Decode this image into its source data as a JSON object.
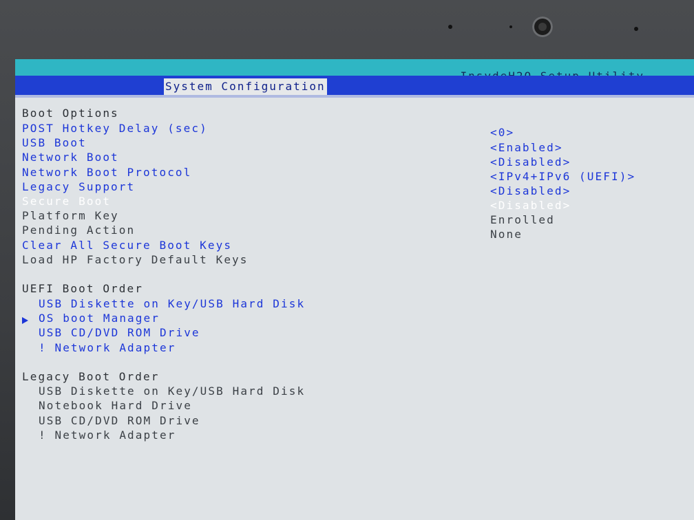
{
  "header": {
    "utility_title": "InsydeH2O Setup Utility",
    "active_menu": "System Configuration"
  },
  "boot_options": {
    "heading": "Boot Options",
    "items": [
      {
        "label": "POST Hotkey Delay (sec)",
        "value": "<0>"
      },
      {
        "label": "USB Boot",
        "value": "<Enabled>"
      },
      {
        "label": "Network Boot",
        "value": "<Disabled>"
      },
      {
        "label": "Network Boot Protocol",
        "value": "<IPv4+IPv6 (UEFI)>"
      },
      {
        "label": "Legacy Support",
        "value": "<Disabled>"
      },
      {
        "label": "Secure Boot",
        "value": "<Disabled>"
      },
      {
        "label": "Platform Key",
        "value": "Enrolled"
      },
      {
        "label": "Pending Action",
        "value": "None"
      },
      {
        "label": "Clear All Secure Boot Keys"
      },
      {
        "label": "Load HP Factory Default Keys"
      }
    ]
  },
  "uefi_boot_order": {
    "heading": "UEFI Boot Order",
    "items": [
      "USB Diskette on Key/USB Hard Disk",
      "OS boot Manager",
      "USB CD/DVD ROM Drive",
      "! Network Adapter"
    ]
  },
  "legacy_boot_order": {
    "heading": "Legacy Boot Order",
    "items": [
      "USB Diskette on Key/USB Hard Disk",
      "Notebook Hard Drive",
      "USB CD/DVD ROM Drive",
      "! Network Adapter"
    ]
  },
  "colors": {
    "screen_background": "#dfe3e6",
    "title_bar": "#2fb6c4",
    "menu_bar": "#1f3fd2",
    "selectable_text": "#1c36d8",
    "selected_text": "#ffffff",
    "static_text": "#3b4046"
  },
  "icons": [
    "camera-icon",
    "arrow-right-icon"
  ]
}
